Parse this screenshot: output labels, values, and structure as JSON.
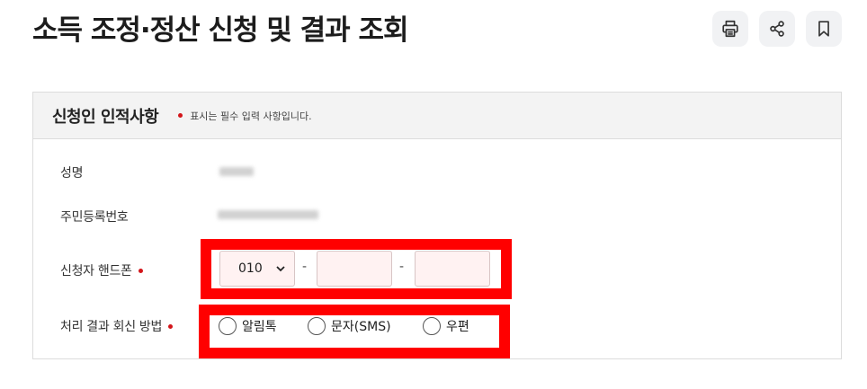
{
  "header": {
    "title": "소득 조정·정산 신청 및 결과 조회"
  },
  "toolbar": {
    "print_icon": "printer-icon",
    "share_icon": "share-icon",
    "bookmark_icon": "bookmark-icon"
  },
  "section": {
    "title": "신청인 인적사항",
    "required_note": "표시는 필수 입력 사항입니다."
  },
  "fields": {
    "name_label": "성명",
    "rrn_label": "주민등록번호",
    "phone_label": "신청자 핸드폰",
    "phone_prefix": "010",
    "phone_separator": "-",
    "method_label": "처리 결과 회신 방법",
    "method_options": [
      "알림톡",
      "문자(SMS)",
      "우편"
    ]
  },
  "colors": {
    "required_dot": "#d3151a",
    "highlight": "#ff0000",
    "input_bg": "#fff2f2"
  }
}
